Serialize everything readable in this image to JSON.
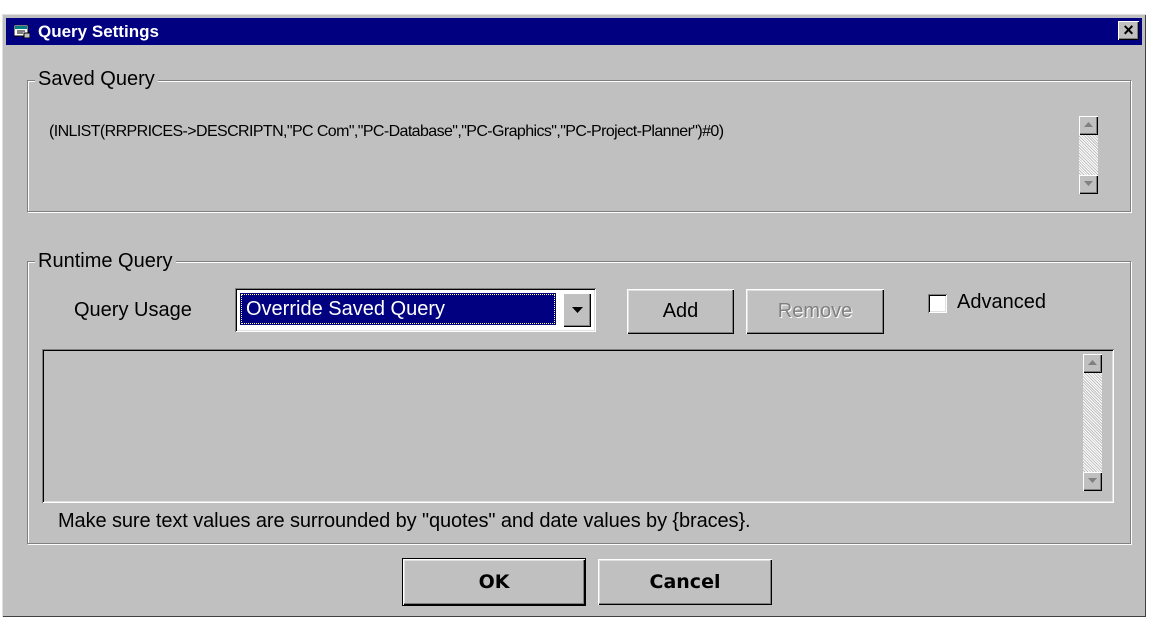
{
  "window": {
    "title": "Query Settings",
    "close_symbol": "×",
    "icon": "query-app-icon"
  },
  "saved_query": {
    "group_label": "Saved Query",
    "text": "(INLIST(RRPRICES->DESCRIPTN,\"PC Com\",\"PC-Database\",\"PC-Graphics\",\"PC-Project-Planner\")#0)"
  },
  "runtime_query": {
    "group_label": "Runtime Query",
    "usage_label": "Query Usage",
    "usage_value": "Override Saved Query",
    "add_label": "Add",
    "remove_label": "Remove",
    "advanced_label": "Advanced",
    "advanced_checked": false,
    "hint": "Make sure text values are surrounded by \"quotes\" and date values by {braces}."
  },
  "buttons": {
    "ok_label": "OK",
    "cancel_label": "Cancel"
  },
  "colors": {
    "titlebar": "#000080",
    "face": "#c0c0c0",
    "selection": "#000080"
  }
}
